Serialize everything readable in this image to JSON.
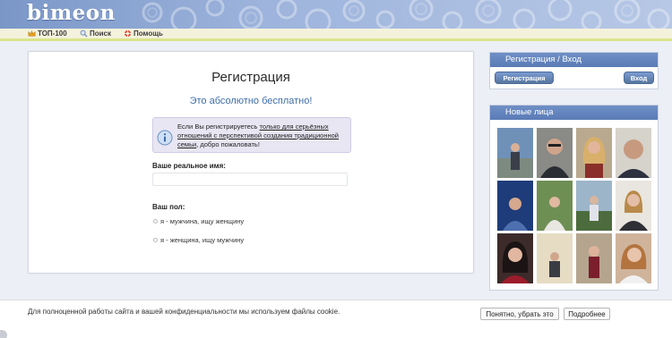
{
  "header": {
    "logo": "bimeon"
  },
  "nav": {
    "items": [
      {
        "label": "ТОП-100",
        "icon": "crown-icon"
      },
      {
        "label": "Поиск",
        "icon": "magnifier-icon"
      },
      {
        "label": "Помощь",
        "icon": "lifebuoy-icon"
      }
    ]
  },
  "registration": {
    "title": "Регистрация",
    "subtitle": "Это абсолютно бесплатно!",
    "notice": {
      "prefix": "Если Вы регистрируетесь ",
      "link": "только для серьёзных отношений с перспективой создания традиционной семьи",
      "suffix": ", добро пожаловать!"
    },
    "name_label": "Ваше реальное имя:",
    "name_value": "",
    "gender_label": "Ваш пол:",
    "gender_options": [
      "я - мужчина, ищу женщину",
      "я - женщина, ищу мужчину"
    ]
  },
  "auth_panel": {
    "title": "Регистрация / Вход",
    "register_label": "Регистрация",
    "login_label": "Вход"
  },
  "faces_panel": {
    "title": "Новые лица"
  },
  "cookie": {
    "text": "Для полноценной работы сайта и вашей конфиденциальности мы используем файлы cookie.",
    "accept_label": "Понятно, убрать это",
    "more_label": "Подробнее"
  },
  "colors": {
    "header_blue": "#7a97c8",
    "panel_head": "#5f80ba",
    "accent_text": "#3f6ea8",
    "nav_underline": "#d9e48a"
  }
}
